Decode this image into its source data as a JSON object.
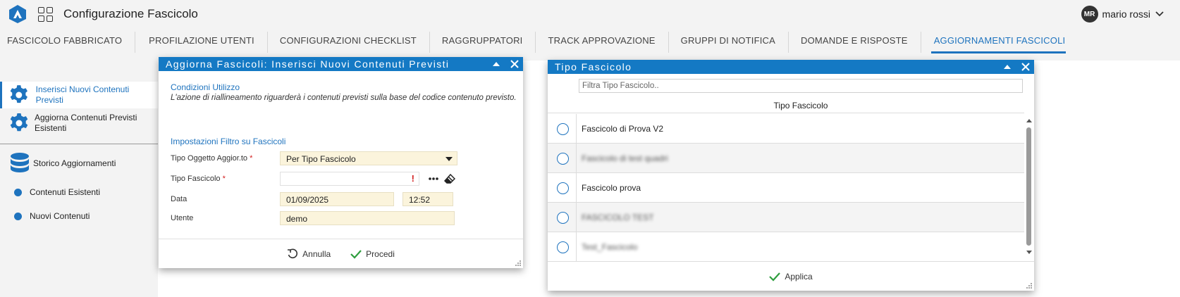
{
  "header": {
    "app_title": "Configurazione Fascicolo",
    "logo_icon": "brand-logo-icon",
    "apps_icon": "app-grid-icon",
    "user_initials": "MR",
    "user_name": "mario rossi",
    "accent": "#1e73be"
  },
  "tabs": [
    {
      "label": "FASCICOLO FABBRICATO",
      "active": false
    },
    {
      "label": "PROFILAZIONE UTENTI",
      "active": false
    },
    {
      "label": "CONFIGURAZIONI CHECKLIST",
      "active": false
    },
    {
      "label": "RAGGRUPPATORI",
      "active": false
    },
    {
      "label": "TRACK APPROVAZIONE",
      "active": false
    },
    {
      "label": "GRUPPI DI NOTIFICA",
      "active": false
    },
    {
      "label": "DOMANDE E RISPOSTE",
      "active": false
    },
    {
      "label": "AGGIORNAMENTI FASCICOLI",
      "active": true
    }
  ],
  "sidebar": {
    "items": [
      {
        "label": "Inserisci Nuovi Contenuti Previsti",
        "icon": "gear-icon",
        "active": true
      },
      {
        "label": "Aggiorna Contenuti Previsti Esistenti",
        "icon": "gear-icon",
        "active": false
      },
      {
        "label": "Storico Aggiornamenti",
        "icon": "database-icon",
        "active": false
      },
      {
        "label": "Contenuti Esistenti",
        "icon": "dot-icon",
        "active": false
      },
      {
        "label": "Nuovi Contenuti",
        "icon": "dot-icon",
        "active": false
      }
    ]
  },
  "dialog_update": {
    "title": "Aggiorna Fascicoli: Inserisci Nuovi Contenuti Previsti",
    "conditions_title": "Condizioni Utilizzo",
    "conditions_text": "L'azione di riallineamento riguarderà i contenuti previsti sulla base del codice contenuto previsto.",
    "filter_title": "Impostazioni Filtro su Fascicoli",
    "fields": {
      "object_type_label": "Tipo Oggetto Aggior.to",
      "object_type_value": "Per Tipo Fascicolo",
      "dossier_type_label": "Tipo Fascicolo",
      "dossier_type_value": "",
      "date_label": "Data",
      "date_value": "01/09/2025",
      "time_value": "12:52",
      "user_label": "Utente",
      "user_value": "demo",
      "required_mark": "*",
      "warning_mark": "!"
    },
    "cancel_label": "Annulla",
    "proceed_label": "Procedi"
  },
  "dialog_type": {
    "title": "Tipo Fascicolo",
    "filter_placeholder": "Filtra Tipo Fascicolo..",
    "column_header": "Tipo Fascicolo",
    "rows": [
      {
        "label": "Fascicolo di Prova V2",
        "blurred": false
      },
      {
        "label": "Fascicolo di test quadri",
        "blurred": true
      },
      {
        "label": "Fascicolo prova",
        "blurred": false
      },
      {
        "label": "FASCICOLO TEST",
        "blurred": true
      },
      {
        "label": "Test_Fascicolo",
        "blurred": true
      }
    ],
    "apply_label": "Applica"
  }
}
